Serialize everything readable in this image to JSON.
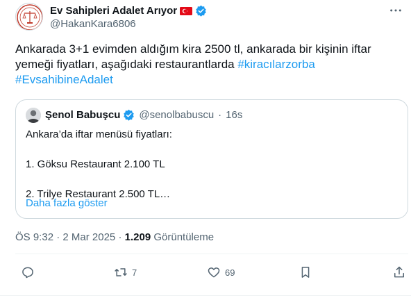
{
  "author": {
    "display_name": "Ev Sahipleri Adalet Arıyor",
    "handle": "@HakanKara6806"
  },
  "tweet": {
    "text_line1": "Ankarada 3+1 evimden aldığım kira 2500 tl, ankarada bir kişinin iftar",
    "text_line2": "yemeği fiyatları,  aşağıdaki restaurantlarda ",
    "hashtag1": "#kiracılarzorba",
    "hashtag2": "#EvsahibineAdalet"
  },
  "quote": {
    "display_name": "Şenol Babuşcu",
    "handle": "@senolbabuscu",
    "separator": "·",
    "time": "16s",
    "line1": "Ankara’da iftar menüsü fiyatları:",
    "line2": "1. Göksu Restaurant  2.100 TL",
    "line3": "2. Trilye Restaurant 2.500 TL…",
    "show_more": "Daha fazla göster"
  },
  "meta": {
    "time": "ÖS 9:32",
    "separator": "·",
    "date": "2 Mar 2025",
    "views_count": "1.209",
    "views_label": "Görüntüleme"
  },
  "actions": {
    "reply_count": "",
    "retweet_count": "7",
    "like_count": "69"
  },
  "colors": {
    "accent": "#1d9bf0",
    "text": "#0f1419",
    "muted": "#536471",
    "border": "#cfd9de"
  }
}
